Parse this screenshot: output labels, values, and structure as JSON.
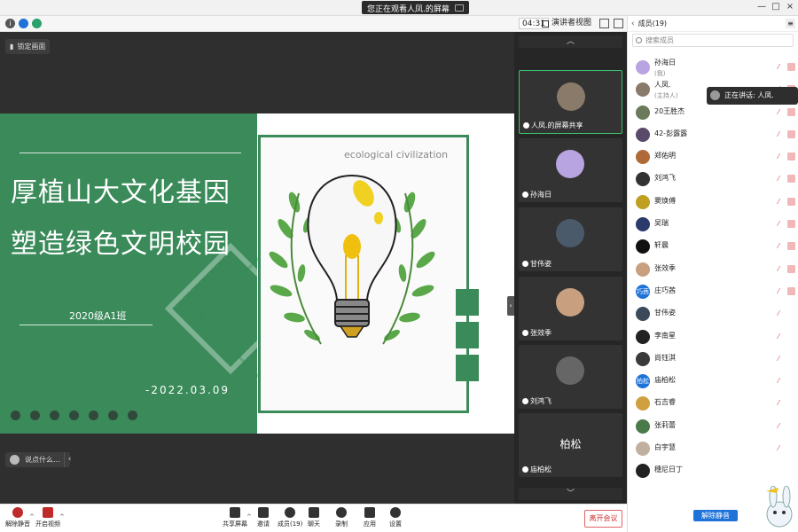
{
  "window": {
    "share_banner": "您正在观看人凤.的屏幕",
    "close": "×",
    "minimize": "—",
    "maximize": "□"
  },
  "meta": {
    "timer": "04:31",
    "view_mode": "演讲者视图"
  },
  "stage": {
    "lock_label": "锁定画面",
    "chat_placeholder": "说点什么...",
    "chat_arrow": "‹",
    "collapse": "›"
  },
  "slide": {
    "title_line1": "厚植山大文化基因",
    "title_line2": "塑造绿色文明校园",
    "class_label": "2020级A1班",
    "date": "-2022.03.09",
    "eco_text": "ecological civilization",
    "accent": "#3a8a5a"
  },
  "thumbs": {
    "up": "︿",
    "down": "﹀",
    "items": [
      {
        "name": "人凤.的屏幕共享",
        "active": true,
        "avatar": "#8a7a6a"
      },
      {
        "name": "孙海日",
        "active": false,
        "avatar": "#b7a4e0"
      },
      {
        "name": "甘伟姿",
        "active": false,
        "avatar": "#4a5a6a"
      },
      {
        "name": "张效季",
        "active": false,
        "avatar": "#c8a080"
      },
      {
        "name": "刘鸿飞",
        "active": false,
        "avatar": "#666666"
      },
      {
        "name": "庙柏松",
        "active": false,
        "avatar_text": "柏松"
      }
    ]
  },
  "bottom": {
    "unmute": "解除静音",
    "video": "开启视频",
    "share_screen": "共享屏幕",
    "invite": "邀请",
    "members": "成员(19)",
    "chat": "聊天",
    "record": "录制",
    "apps": "应用",
    "settings": "设置",
    "leave": "离开会议",
    "caret": "^"
  },
  "panel": {
    "title": "成员(19)",
    "back": "‹",
    "menu": "≡",
    "search_placeholder": "搜索成员",
    "unmute_all": "解除静音",
    "speaking": "正在讲话: 人凤.",
    "members": [
      {
        "name": "孙海日",
        "role": "(我)",
        "avatar_color": "#b7a4e0",
        "mic": "muted",
        "cam": true
      },
      {
        "name": "人凤.",
        "role": "(主持人)",
        "avatar_color": "#8a7a6a",
        "mic": "muted",
        "cam": true
      },
      {
        "name": "20王胜杰",
        "role": "",
        "avatar_color": "#6a7a5a",
        "mic": "muted",
        "cam": true
      },
      {
        "name": "42-彭露露",
        "role": "",
        "avatar_color": "#5a4a6a",
        "mic": "muted",
        "cam": true
      },
      {
        "name": "郑佑明",
        "role": "",
        "avatar_color": "#b06a3a",
        "mic": "muted",
        "cam": true
      },
      {
        "name": "刘鸿飞",
        "role": "",
        "avatar_color": "#333333",
        "mic": "muted",
        "cam": true
      },
      {
        "name": "窦焕傅",
        "role": "",
        "avatar_color": "#c0a020",
        "mic": "muted",
        "cam": true
      },
      {
        "name": "吴瑞",
        "role": "",
        "avatar_color": "#2a3a6a",
        "mic": "muted",
        "cam": true
      },
      {
        "name": "轩晨",
        "role": "",
        "avatar_color": "#111111",
        "mic": "muted",
        "cam": true
      },
      {
        "name": "张效季",
        "role": "",
        "avatar_color": "#c8a080",
        "mic": "muted",
        "cam": true
      },
      {
        "name": "庄巧茜",
        "role": "",
        "avatar_color": "#1e72d8",
        "avatar_text": "巧茜",
        "mic": "muted",
        "cam": true
      },
      {
        "name": "甘伟姿",
        "role": "",
        "avatar_color": "#3a4a5a",
        "mic": "muted",
        "cam": false
      },
      {
        "name": "李南星",
        "role": "",
        "avatar_color": "#222222",
        "mic": "muted",
        "cam": false
      },
      {
        "name": "尚钰淇",
        "role": "",
        "avatar_color": "#3a3a3a",
        "mic": "muted",
        "cam": false
      },
      {
        "name": "庙柏松",
        "role": "",
        "avatar_color": "#1e72d8",
        "avatar_text": "柏松",
        "mic": "muted",
        "cam": false
      },
      {
        "name": "石吉睿",
        "role": "",
        "avatar_color": "#d0a040",
        "mic": "muted",
        "cam": false
      },
      {
        "name": "张莉蕾",
        "role": "",
        "avatar_color": "#4a7a4a",
        "mic": "muted",
        "cam": false
      },
      {
        "name": "白宇慧",
        "role": "",
        "avatar_color": "#c0b0a0",
        "mic": "muted",
        "cam": false
      },
      {
        "name": "穗尼日丁",
        "role": "",
        "avatar_color": "#222222",
        "mic": "none",
        "cam": false
      }
    ]
  }
}
